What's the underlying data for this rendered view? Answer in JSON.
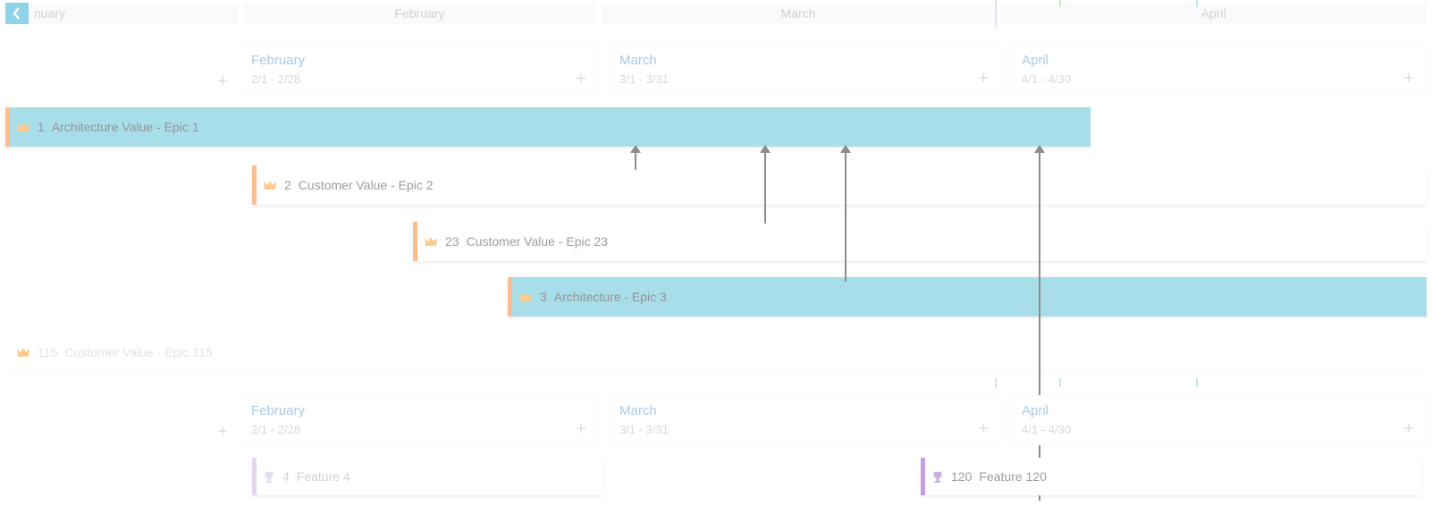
{
  "months_header": {
    "m0": "nuary",
    "m1": "February",
    "m2": "March",
    "m3": "April"
  },
  "periods_top": {
    "feb": {
      "title": "February",
      "range": "2/1 - 2/28"
    },
    "mar": {
      "title": "March",
      "range": "3/1 - 3/31"
    },
    "apr": {
      "title": "April",
      "range": "4/1 - 4/30"
    }
  },
  "periods_bottom": {
    "feb": {
      "title": "February",
      "range": "2/1 - 2/28"
    },
    "mar": {
      "title": "March",
      "range": "3/1 - 3/31"
    },
    "apr": {
      "title": "April",
      "range": "4/1 - 4/30"
    }
  },
  "epics": {
    "e1": {
      "id": "1",
      "title": "Architecture Value - Epic 1"
    },
    "e2": {
      "id": "2",
      "title": "Customer Value - Epic 2"
    },
    "e23": {
      "id": "23",
      "title": "Customer Value - Epic 23"
    },
    "e3": {
      "id": "3",
      "title": "Architecture - Epic 3"
    },
    "e115": {
      "id": "115",
      "title": "Customer Value - Epic 115"
    }
  },
  "features": {
    "f4": {
      "id": "4",
      "title": "Feature 4"
    },
    "f120": {
      "id": "120",
      "title": "Feature 120"
    }
  },
  "icons": {
    "crown": "crown-icon",
    "trophy": "trophy-icon",
    "add": "+"
  },
  "colors": {
    "teal": "#3fb4d0",
    "orange": "#ff6a00",
    "purple": "#7b2fb5",
    "lpurple": "#c9a0e0"
  }
}
